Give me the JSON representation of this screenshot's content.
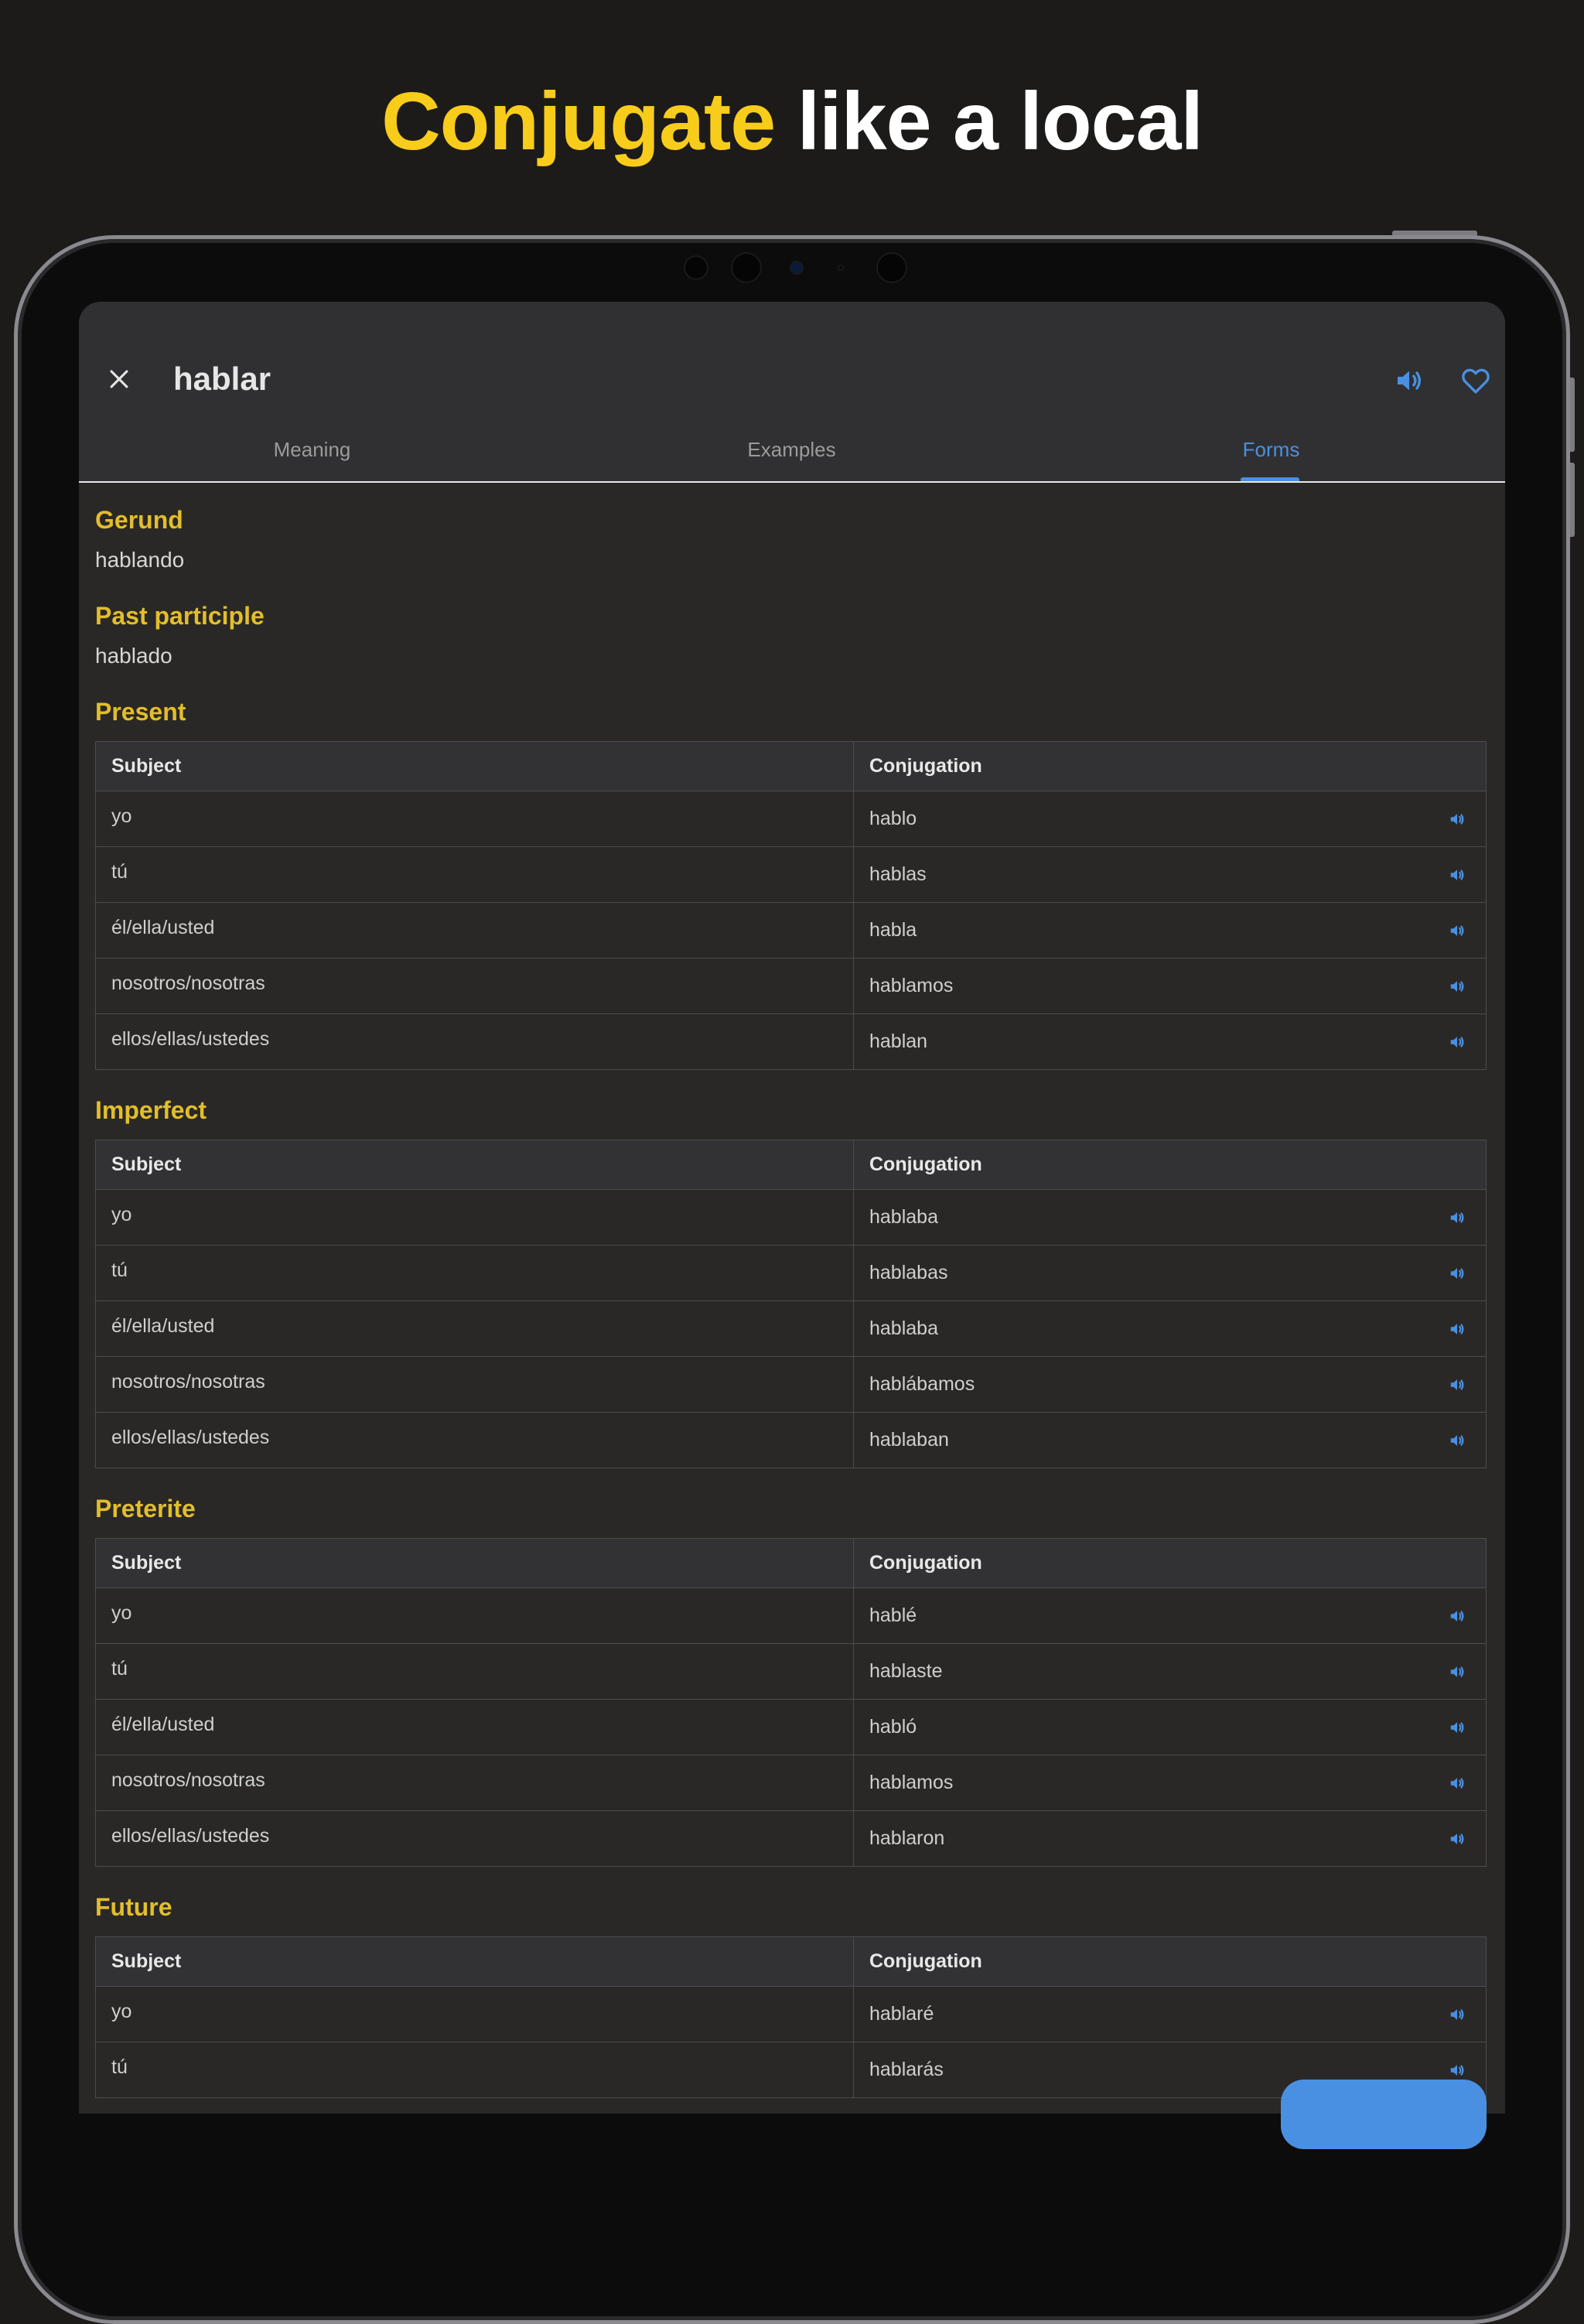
{
  "headline": {
    "accent": "Conjugate",
    "rest": " like a local"
  },
  "app": {
    "title": "hablar",
    "tabs": [
      {
        "label": "Meaning",
        "active": false
      },
      {
        "label": "Examples",
        "active": false
      },
      {
        "label": "Forms",
        "active": true
      }
    ],
    "colors": {
      "accent_blue": "#4a90e2",
      "section_gold": "#e2be2c",
      "headline_yellow": "#f8cc1b"
    },
    "icons": {
      "close": "close-icon",
      "speaker": "speaker-icon",
      "favorite": "heart-icon"
    }
  },
  "forms": {
    "gerund": {
      "label": "Gerund",
      "value": "hablando"
    },
    "participle": {
      "label": "Past participle",
      "value": "hablado"
    },
    "tenses": [
      {
        "title": "Present",
        "subject_header": "Subject",
        "conjugation_header": "Conjugation",
        "rows": [
          {
            "subject": "yo",
            "form": "hablo"
          },
          {
            "subject": "tú",
            "form": "hablas"
          },
          {
            "subject": "él/ella/usted",
            "form": "habla"
          },
          {
            "subject": "nosotros/nosotras",
            "form": "hablamos"
          },
          {
            "subject": "ellos/ellas/ustedes",
            "form": "hablan"
          }
        ]
      },
      {
        "title": "Imperfect",
        "subject_header": "Subject",
        "conjugation_header": "Conjugation",
        "rows": [
          {
            "subject": "yo",
            "form": "hablaba"
          },
          {
            "subject": "tú",
            "form": "hablabas"
          },
          {
            "subject": "él/ella/usted",
            "form": "hablaba"
          },
          {
            "subject": "nosotros/nosotras",
            "form": "hablábamos"
          },
          {
            "subject": "ellos/ellas/ustedes",
            "form": "hablaban"
          }
        ]
      },
      {
        "title": "Preterite",
        "subject_header": "Subject",
        "conjugation_header": "Conjugation",
        "rows": [
          {
            "subject": "yo",
            "form": "hablé"
          },
          {
            "subject": "tú",
            "form": "hablaste"
          },
          {
            "subject": "él/ella/usted",
            "form": "habló"
          },
          {
            "subject": "nosotros/nosotras",
            "form": "hablamos"
          },
          {
            "subject": "ellos/ellas/ustedes",
            "form": "hablaron"
          }
        ]
      },
      {
        "title": "Future",
        "subject_header": "Subject",
        "conjugation_header": "Conjugation",
        "rows": [
          {
            "subject": "yo",
            "form": "hablaré"
          },
          {
            "subject": "tú",
            "form": "hablarás"
          }
        ]
      }
    ]
  }
}
